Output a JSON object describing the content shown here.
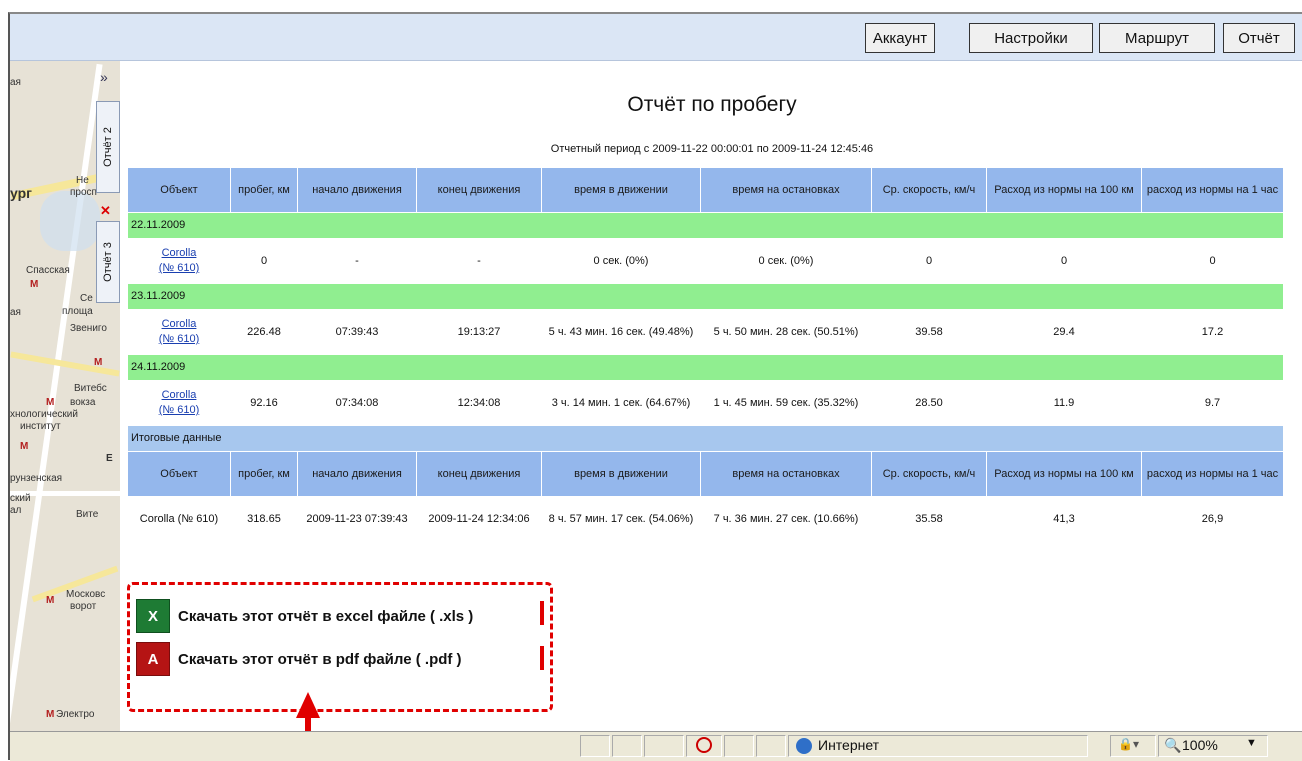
{
  "toolbar": {
    "account": "Аккаунт",
    "settings": "Настройки",
    "route": "Маршрут",
    "report": "Отчёт"
  },
  "sidetabs": {
    "collapse": "»",
    "report2": "Отчёт 2",
    "report3": "Отчёт 3",
    "close": "✕"
  },
  "map": {
    "labels": [
      "ая",
      "Не",
      "просп",
      "ург",
      "Спасская",
      "Се",
      "площа",
      "ая",
      "Звениго",
      "Витебс",
      "вокза",
      "хнологический",
      "институт",
      "рунзенская",
      "Е",
      "ский",
      "ал",
      "Вите",
      "Московс",
      "ворот",
      "Электро"
    ]
  },
  "report": {
    "title": "Отчёт по пробегу",
    "period": "Отчетный период с 2009-11-22 00:00:01 по 2009-11-24 12:45:46",
    "headers": [
      "Объект",
      "пробег, км",
      "начало движения",
      "конец движения",
      "время в движении",
      "время на остановках",
      "Ср. скорость, км/ч",
      "Расход из нормы на 100 км",
      "расход из нормы на 1 час"
    ],
    "days": [
      {
        "date": "22.11.2009",
        "object1": "Corolla",
        "object2": "(№ 610)",
        "cells": [
          "0",
          "-",
          "-",
          "0 сек. (0%)",
          "0 сек. (0%)",
          "0",
          "0",
          "0"
        ]
      },
      {
        "date": "23.11.2009",
        "object1": "Corolla",
        "object2": "(№ 610)",
        "cells": [
          "226.48",
          "07:39:43",
          "19:13:27",
          "5 ч. 43 мин. 16 сек. (49.48%)",
          "5 ч. 50 мин. 28 сек. (50.51%)",
          "39.58",
          "29.4",
          "17.2"
        ]
      },
      {
        "date": "24.11.2009",
        "object1": "Corolla",
        "object2": "(№ 610)",
        "cells": [
          "92.16",
          "07:34:08",
          "12:34:08",
          "3 ч. 14 мин. 1 сек. (64.67%)",
          "1 ч. 45 мин. 59 сек. (35.32%)",
          "28.50",
          "11.9",
          "9.7"
        ]
      }
    ],
    "summary_label": "Итоговые данные",
    "summary": [
      "Corolla (№ 610)",
      "318.65",
      "2009-11-23 07:39:43",
      "2009-11-24 12:34:06",
      "8 ч. 57 мин. 17 сек. (54.06%)",
      "7 ч. 36 мин. 27 сек. (10.66%)",
      "35.58",
      "41,3",
      "26,9"
    ]
  },
  "downloads": {
    "xls": "Скачать этот отчёт в excel файле ( .xls )",
    "pdf": "Скачать этот отчёт в pdf файле ( .pdf )",
    "xls_icon": "X",
    "pdf_icon": "A"
  },
  "statusbar": {
    "zone": "Интернет",
    "zoom": "100%"
  },
  "colors": {
    "header_blue": "#94b7ec",
    "date_green": "#90ee90",
    "annotation_red": "#e00000"
  }
}
